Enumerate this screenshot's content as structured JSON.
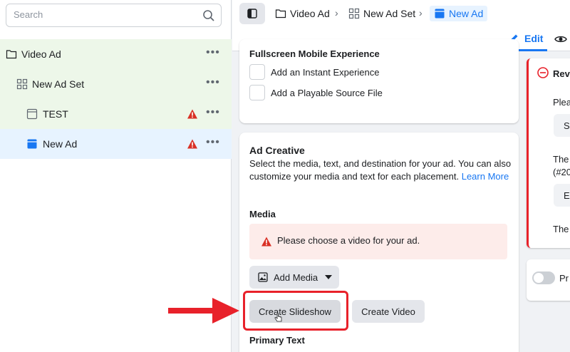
{
  "search": {
    "placeholder": "Search"
  },
  "tree": [
    {
      "label": "Video Ad",
      "icon": "folder-icon",
      "warn": false
    },
    {
      "label": "New Ad Set",
      "icon": "grid-icon",
      "warn": true
    },
    {
      "label": "TEST",
      "icon": "ad-icon",
      "warn": true
    },
    {
      "label": "New Ad",
      "icon": "ad-icon-filled",
      "warn": true
    }
  ],
  "breadcrumb": {
    "campaign": "Video Ad",
    "adset": "New Ad Set",
    "ad": "New Ad"
  },
  "tabs": {
    "edit": "Edit"
  },
  "fullscreen": {
    "title": "Fullscreen Mobile Experience",
    "options": [
      "Add an Instant Experience",
      "Add a Playable Source File"
    ]
  },
  "creative": {
    "title": "Ad Creative",
    "desc": "Select the media, text, and destination for your ad. You can also customize your media and text for each placement.",
    "learn_more": "Learn More",
    "media_label": "Media",
    "alert": "Please choose a video for your ad.",
    "add_media": "Add Media",
    "create_slideshow": "Create Slideshow",
    "create_video": "Create Video",
    "primary_text": "Primary Text"
  },
  "review": {
    "title": "Revi",
    "line1": "Plea",
    "btn1": "Se",
    "line2": "The",
    "line3": "(#20",
    "btn2": "Ec",
    "line4": "The"
  },
  "preview": {
    "label": "Pr"
  },
  "colors": {
    "accent": "#1877f2",
    "error": "#e8212a",
    "tree_bg": "#edf7e9"
  }
}
